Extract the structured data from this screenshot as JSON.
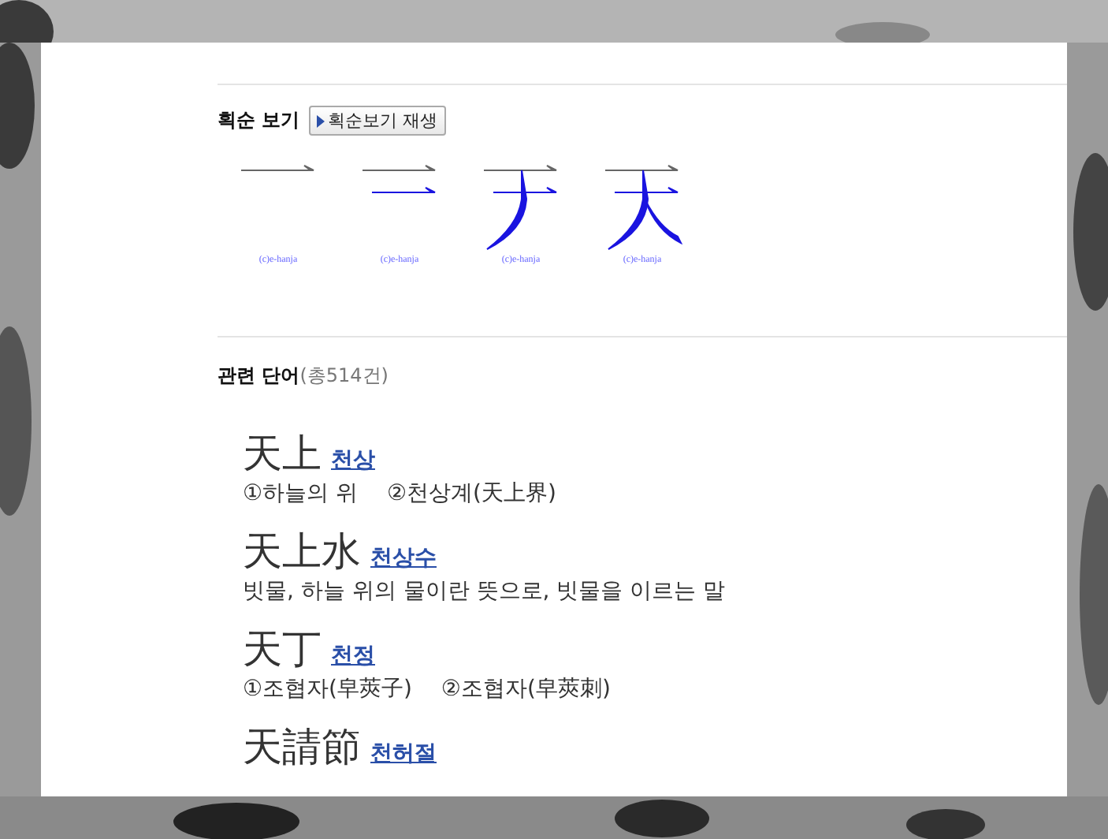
{
  "stroke_order": {
    "title": "획순 보기",
    "play_button": "획순보기 재생",
    "frames": [
      {
        "caption": "(c)e-hanja"
      },
      {
        "caption": "(c)e-hanja"
      },
      {
        "caption": "(c)e-hanja"
      },
      {
        "caption": "(c)e-hanja"
      }
    ]
  },
  "related_words": {
    "title": "관련 단어",
    "count": "(총514건)",
    "entries": [
      {
        "hanja": "天上",
        "reading": "천상",
        "meaning": "①하늘의 위　 ②천상계(天上界)"
      },
      {
        "hanja": "天上水",
        "reading": "천상수",
        "meaning": "빗물, 하늘 위의 물이란 뜻으로, 빗물을 이르는 말"
      },
      {
        "hanja": "天丁",
        "reading": "천정",
        "meaning": "①조협자(皁莢子)　 ②조협자(皁莢刺)"
      },
      {
        "hanja": "天請節",
        "reading": "천허절"
      }
    ]
  }
}
